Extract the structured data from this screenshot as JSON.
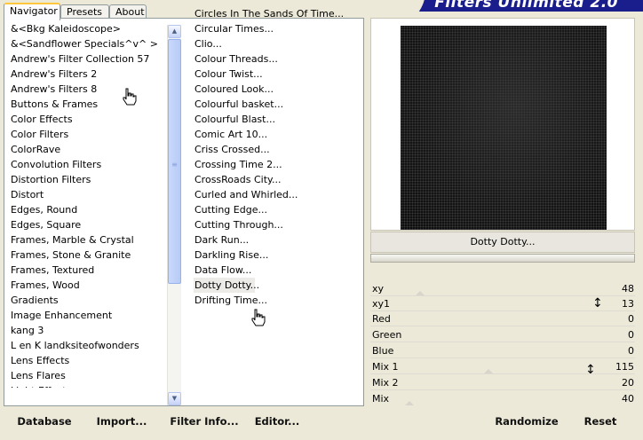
{
  "app": {
    "title": "Filters Unlimited 2.0"
  },
  "tabs": [
    {
      "label": "Navigator",
      "active": true
    },
    {
      "label": "Presets",
      "active": false
    },
    {
      "label": "About",
      "active": false
    }
  ],
  "categories": {
    "items": [
      "&<Bkg Kaleidoscope>",
      "&<Sandflower Specials^v^ >",
      "Andrew's Filter Collection 57",
      "Andrew's Filters 2",
      "Andrew's Filters 8",
      "Buttons & Frames",
      "Color Effects",
      "Color Filters",
      "ColorRave",
      "Convolution Filters",
      "Distortion Filters",
      "Distort",
      "Edges, Round",
      "Edges, Square",
      "Frames, Marble & Crystal",
      "Frames, Stone & Granite",
      "Frames, Textured",
      "Frames, Wood",
      "Gradients",
      "Image Enhancement",
      "kang 3",
      "L en K landksiteofwonders",
      "Lens Effects",
      "Lens Flares",
      "Light Effects"
    ],
    "scroll_position": 0.0
  },
  "filters": {
    "items": [
      "Circles In The Sands Of Time...",
      "Circular Times...",
      "Clio...",
      "Colour Threads...",
      "Colour Twist...",
      "Coloured Look...",
      "Colourful basket...",
      "Colourful Blast...",
      "Comic Art 10...",
      "Criss Crossed...",
      "Crossing Time 2...",
      "CrossRoads City...",
      "Curled and Whirled...",
      "Cutting Edge...",
      "Cutting Through...",
      "Dark Run...",
      "Darkling Rise...",
      "Data Flow...",
      "Dotty Dotty...",
      "Drifting Time..."
    ],
    "selected_index": 18
  },
  "preview": {
    "filter_name": "Dotty Dotty...",
    "progress": 0
  },
  "parameters": [
    {
      "name": "xy",
      "value": "48",
      "level": 0.19
    },
    {
      "name": "xy1",
      "value": "13",
      "level": 0.05
    },
    {
      "name": "Red",
      "value": "0",
      "level": 0.0
    },
    {
      "name": "Green",
      "value": "0",
      "level": 0.0
    },
    {
      "name": "Blue",
      "value": "0",
      "level": 0.0
    },
    {
      "name": "Mix 1",
      "value": "115",
      "level": 0.45
    },
    {
      "name": "Mix 2",
      "value": "20",
      "level": 0.08
    },
    {
      "name": "Mix",
      "value": "40",
      "level": 0.16
    }
  ],
  "buttons": {
    "database": "Database",
    "import": "Import...",
    "filter_info": "Filter Info...",
    "editor": "Editor...",
    "randomize": "Randomize",
    "reset": "Reset"
  },
  "icons": {
    "scroll_up": "scroll-up-arrow-icon",
    "scroll_down": "scroll-down-arrow-icon",
    "cursor": "hand-pointer-icon",
    "resize": "vertical-resize-icon"
  }
}
